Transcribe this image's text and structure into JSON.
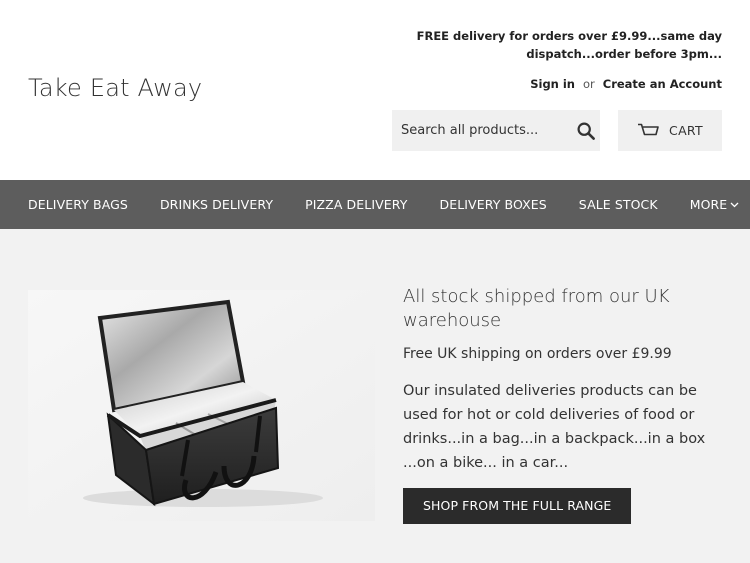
{
  "header": {
    "logo": "Take Eat Away",
    "promo_line1": "FREE delivery for orders over £9.99...same day",
    "promo_line2": "dispatch...order before 3pm...",
    "sign_in": "Sign in",
    "or": "or",
    "create_account": "Create an Account",
    "search_placeholder": "Search all products...",
    "search_icon": "search-icon",
    "cart_label": "CART",
    "cart_icon": "cart-icon"
  },
  "nav": {
    "items": [
      {
        "label": "DELIVERY BAGS"
      },
      {
        "label": "DRINKS DELIVERY"
      },
      {
        "label": "PIZZA DELIVERY"
      },
      {
        "label": "DELIVERY BOXES"
      },
      {
        "label": "SALE STOCK"
      },
      {
        "label": "MORE"
      }
    ],
    "more_icon": "chevron-down-icon"
  },
  "hero": {
    "image": "insulated-delivery-bag",
    "heading": "All stock shipped from our UK warehouse",
    "subheading": "Free UK shipping on orders over £9.99",
    "body": "Our insulated deliveries products can be used for hot or cold deliveries of food or drinks...in a bag...in a backpack...in a box ...on a bike... in a car...",
    "cta": "SHOP FROM THE FULL RANGE"
  },
  "colors": {
    "nav_bg": "#5d5d5d",
    "main_bg": "#f2f2f2",
    "button_bg": "#2b2b2b",
    "field_bg": "#f0f0f0"
  }
}
